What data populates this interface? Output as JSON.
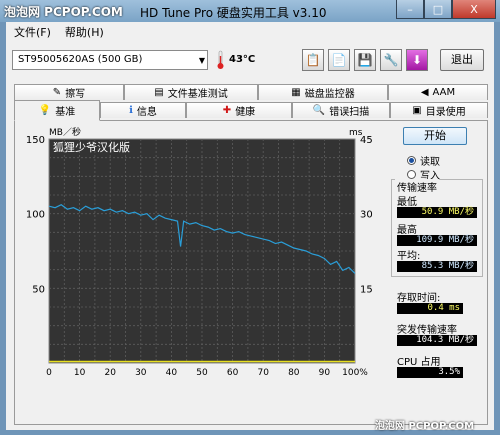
{
  "window": {
    "title": "HD Tune Pro 硬盘实用工具 v3.10",
    "watermark_top": "泡泡网 PCPOP.COM",
    "watermark_bottom": "泡泡网 PCPOP.COM",
    "min": "–",
    "max": "□",
    "close": "X"
  },
  "menu": {
    "file": "文件(F)",
    "help": "帮助(H)"
  },
  "toolbar": {
    "drive": "ST95005620AS (500 GB)",
    "temperature": "43°C",
    "exit_label": "退出"
  },
  "tabs_row1": [
    {
      "icon": "✎",
      "label": "擦写"
    },
    {
      "icon": "▤",
      "label": "文件基准测试"
    },
    {
      "icon": "▦",
      "label": "磁盘监控器"
    },
    {
      "icon": "◀",
      "label": "AAM"
    }
  ],
  "tabs_row2": [
    {
      "icon": "💡",
      "label": "基准"
    },
    {
      "icon": "ℹ",
      "label": "信息"
    },
    {
      "icon": "✚",
      "label": "健康"
    },
    {
      "icon": "🔍",
      "label": "错误扫描"
    },
    {
      "icon": "▣",
      "label": "目录使用"
    }
  ],
  "chart_data": {
    "type": "line",
    "overlay_text": "狐狸少爷汉化版",
    "ylabel_left": "MB／秒",
    "ylabel_right": "ms",
    "left_ticks": [
      "150",
      "100",
      "50"
    ],
    "right_ticks": [
      "45",
      "30",
      "15"
    ],
    "x_ticks": [
      "0",
      "10",
      "20",
      "30",
      "40",
      "50",
      "60",
      "70",
      "80",
      "90",
      "100%"
    ],
    "xlim": [
      0,
      100
    ],
    "ylim": [
      0,
      150
    ],
    "y2lim": [
      0,
      45
    ],
    "grid": true,
    "series": [
      {
        "color": "#2a9ed8",
        "x": [
          0,
          2,
          4,
          6,
          8,
          10,
          12,
          14,
          16,
          18,
          20,
          22,
          24,
          26,
          28,
          30,
          32,
          34,
          36,
          38,
          40,
          42,
          43,
          44,
          46,
          48,
          50,
          52,
          54,
          56,
          58,
          60,
          62,
          64,
          66,
          68,
          70,
          72,
          74,
          76,
          78,
          80,
          82,
          84,
          86,
          88,
          90,
          92,
          94,
          96,
          98,
          100
        ],
        "values": [
          105,
          104,
          106,
          103,
          104,
          102,
          105,
          103,
          104,
          102,
          103,
          101,
          102,
          100,
          101,
          99,
          100,
          96,
          99,
          97,
          96,
          95,
          78,
          95,
          93,
          94,
          92,
          91,
          89,
          90,
          88,
          87,
          88,
          86,
          85,
          84,
          83,
          82,
          80,
          81,
          79,
          77,
          76,
          75,
          73,
          72,
          70,
          66,
          68,
          62,
          64,
          60
        ]
      },
      {
        "color": "#e8e020",
        "x": [
          0,
          10,
          20,
          30,
          40,
          50,
          60,
          70,
          80,
          90,
          100
        ],
        "values": [
          1,
          1,
          1,
          1,
          1,
          1,
          1,
          1,
          1,
          1,
          1
        ]
      }
    ]
  },
  "controls": {
    "start_label": "开始",
    "read_label": "读取",
    "write_label": "写入",
    "read_selected": true
  },
  "stats": {
    "transfer_title": "传输速率",
    "min_label": "最低",
    "min_value": "50.9 MB/秒",
    "max_label": "最高",
    "max_value": "109.9 MB/秒",
    "avg_label": "平均:",
    "avg_value": "85.3 MB/秒",
    "access_label": "存取时间:",
    "access_value": "0.4 ms",
    "burst_label": "突发传输速率",
    "burst_value": "104.3 MB/秒",
    "cpu_label": "CPU 占用",
    "cpu_value": "3.5%"
  }
}
